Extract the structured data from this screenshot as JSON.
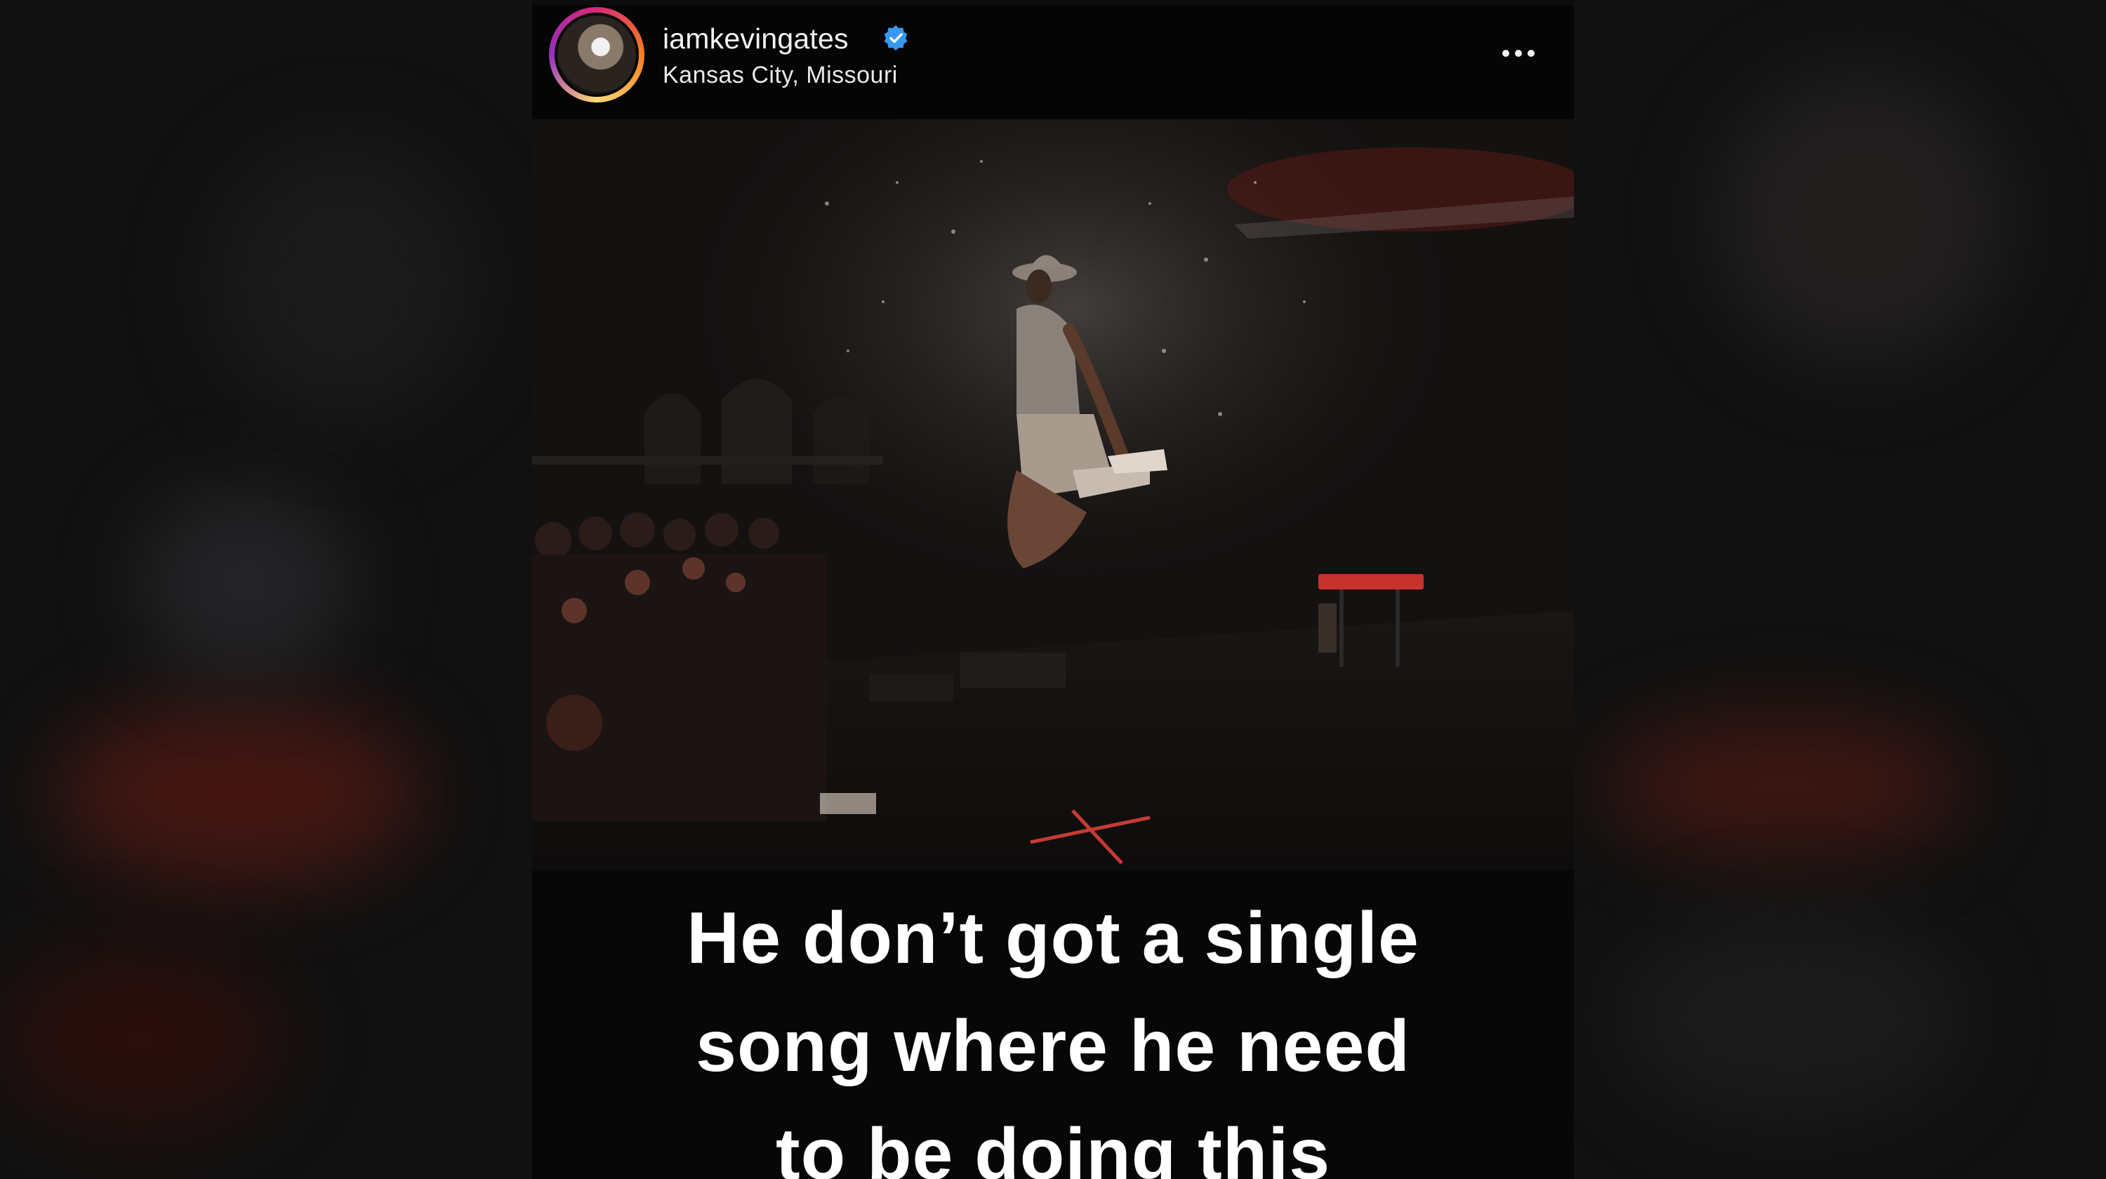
{
  "post": {
    "username": "iamkevingates",
    "location": "Kansas City, Missouri",
    "verified": true,
    "caption_lines": [
      "He don’t got a single",
      "song where he need",
      "to be doing this"
    ]
  },
  "icons": {
    "verified": "verified-badge-icon",
    "more": "more-options-icon"
  },
  "colors": {
    "verified_blue": "#3897f0",
    "story_ring": "#d62976",
    "stage_marker": "#e8423a",
    "keyboard_red": "#c8322c"
  }
}
